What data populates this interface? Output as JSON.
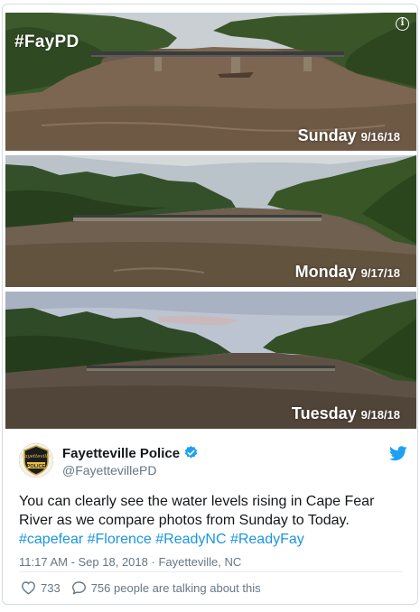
{
  "media": {
    "overlay_hashtag": "#FayPD",
    "info_icon": "info-icon",
    "photos": [
      {
        "day": "Sunday",
        "date": "9/16/18"
      },
      {
        "day": "Monday",
        "date": "9/17/18"
      },
      {
        "day": "Tuesday",
        "date": "9/18/18"
      }
    ]
  },
  "author": {
    "name": "Fayetteville Police",
    "handle": "@FayettevillePD",
    "avatar_text_top": "Fayetteville",
    "avatar_text_bottom": "POLICE",
    "verified_icon": "verified-badge-icon",
    "platform_icon": "twitter-bird-icon"
  },
  "tweet": {
    "text": "You can clearly see the water levels rising in Cape Fear River as we compare photos from Sunday to Today.",
    "hashtags": [
      "#capefear",
      "#Florence",
      "#ReadyNC",
      "#ReadyFay"
    ]
  },
  "meta": {
    "time": "11:17 AM - Sep 18, 2018",
    "separator": "·",
    "location": "Fayetteville, NC"
  },
  "actions": {
    "like_icon": "heart-icon",
    "like_count": "733",
    "reply_icon": "speech-bubble-icon",
    "reply_text": "756 people are talking about this"
  },
  "colors": {
    "link": "#1b95e0",
    "text": "#14171a",
    "muted": "#657786",
    "border": "#d3dbe1"
  }
}
